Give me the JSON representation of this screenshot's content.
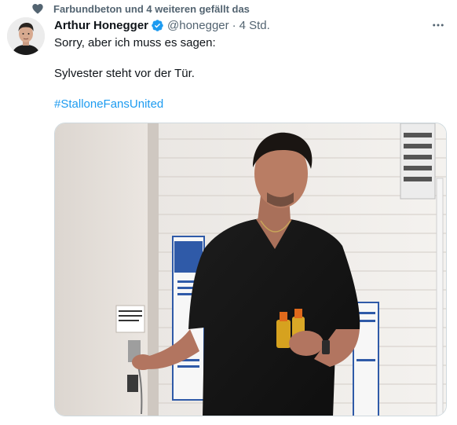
{
  "social_context": {
    "text": "Farbundbeton und 4 weiteren gefällt das",
    "icon": "heart-icon"
  },
  "author": {
    "name": "Arthur Honegger",
    "handle": "@honegger",
    "separator": "·",
    "time": "4 Std.",
    "verified_color": "#1d9bf0"
  },
  "tweet": {
    "line1": "Sorry, aber ich muss es sagen:",
    "line2": "Sylvester steht vor der Tür.",
    "hashtag": "#StalloneFansUnited",
    "hashtag_color": "#1d9bf0"
  },
  "sign": {
    "text": "BACK THIS DOOR AFTER OPENING"
  },
  "colors": {
    "text_primary": "#0f1419",
    "text_secondary": "#536471",
    "border": "#cfd9de"
  }
}
